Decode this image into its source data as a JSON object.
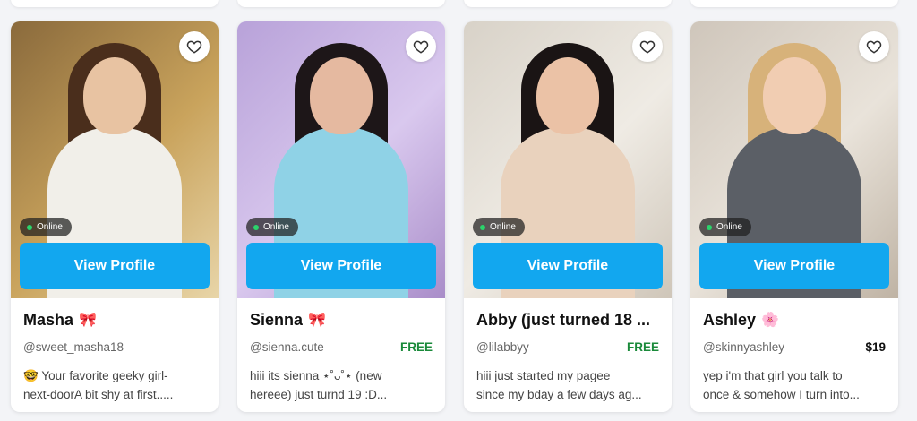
{
  "cards": [
    {
      "name": "Masha",
      "name_emoji": "🎀",
      "handle": "@sweet_masha18",
      "price": "",
      "bio_line1": "🤓 Your favorite geeky girl-",
      "bio_line2": "next-doorA bit shy at first.....",
      "status": "Online",
      "button": "View Profile",
      "photo_colors": [
        "#8a6a3c",
        "#c9a35c",
        "#e8d5a8"
      ],
      "skin": "#e8c3a2",
      "hair": "#4a2e1c",
      "outfit": "#f1efe9"
    },
    {
      "name": "Sienna",
      "name_emoji": "🎀",
      "handle": "@sienna.cute",
      "price": "FREE",
      "bio_line1": "hiii its sienna ⋆˚ᴗ˚⋆ (new",
      "bio_line2": "hereee) just turnd 19 :D...",
      "status": "Online",
      "button": "View Profile",
      "photo_colors": [
        "#b8a2d9",
        "#d9c8ee",
        "#a98dc9"
      ],
      "skin": "#e5b9a0",
      "hair": "#1d1618",
      "outfit": "#8fd2e6"
    },
    {
      "name": "Abby (just turned 18 ...",
      "name_emoji": "",
      "handle": "@lilabbyy",
      "price": "FREE",
      "bio_line1": "hiii just started my pagee",
      "bio_line2": "since my bday a few days ag...",
      "status": "Online",
      "button": "View Profile",
      "photo_colors": [
        "#d8d2c8",
        "#efebe4",
        "#cfc6b9"
      ],
      "skin": "#ebc2a6",
      "hair": "#1a1414",
      "outfit": "#e9d2bd"
    },
    {
      "name": "Ashley",
      "name_emoji": "🌸",
      "handle": "@skinnyashley",
      "price": "$19",
      "bio_line1": "yep i'm that girl you talk to",
      "bio_line2": "once & somehow I turn into...",
      "status": "Online",
      "button": "View Profile",
      "photo_colors": [
        "#cfc6bb",
        "#e9e3da",
        "#bfb3a4"
      ],
      "skin": "#f1cdb2",
      "hair": "#d7b27a",
      "outfit": "#5b5f66"
    }
  ],
  "price_colors": {
    "free": "#1a8a3a",
    "paid": "#111111"
  }
}
